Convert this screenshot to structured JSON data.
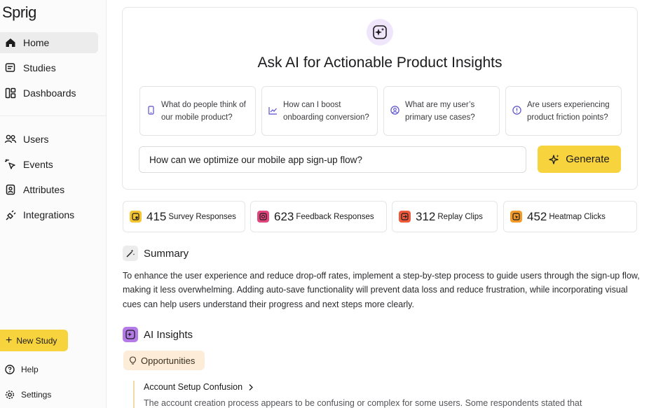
{
  "app": {
    "logo": "Sprig"
  },
  "sidebar": {
    "items": [
      {
        "label": "Home",
        "icon": "home-icon",
        "active": true
      },
      {
        "label": "Studies",
        "icon": "studies-icon"
      },
      {
        "label": "Dashboards",
        "icon": "dashboards-icon"
      },
      {
        "label": "Users",
        "icon": "users-icon"
      },
      {
        "label": "Events",
        "icon": "events-icon"
      },
      {
        "label": "Attributes",
        "icon": "attributes-icon"
      },
      {
        "label": "Integrations",
        "icon": "integrations-icon"
      }
    ],
    "new_study": "New Study",
    "footer": [
      {
        "label": "Help",
        "icon": "help-icon"
      },
      {
        "label": "Settings",
        "icon": "settings-icon"
      }
    ]
  },
  "ai_panel": {
    "badge_icon": "sparkle-icon",
    "title": "Ask AI for Actionable Product Insights",
    "suggestions": [
      {
        "text": "What do people think of our mobile product?",
        "icon": "mobile-icon"
      },
      {
        "text": "How can I boost onboarding conversion?",
        "icon": "trend-chart-icon"
      },
      {
        "text": "What are my user’s primary use cases?",
        "icon": "user-circle-icon"
      },
      {
        "text": "Are users experiencing product friction points?",
        "icon": "alert-circle-icon"
      }
    ],
    "query_value": "How can we optimize our mobile app sign-up flow?",
    "generate_label": "Generate"
  },
  "stats": [
    {
      "value": "415",
      "label": "Survey Responses",
      "color": "#f5c431",
      "icon": "survey-icon"
    },
    {
      "value": "623",
      "label": "Feedback Responses",
      "color": "#e0457b",
      "icon": "feedback-icon"
    },
    {
      "value": "312",
      "label": "Replay Clips",
      "color": "#ef5a3c",
      "icon": "replay-icon"
    },
    {
      "value": "452",
      "label": "Heatmap Clicks",
      "color": "#f39a2b",
      "icon": "heatmap-icon"
    }
  ],
  "summary": {
    "heading": "Summary",
    "text": "To enhance the user experience and reduce drop-off rates, implement a step-by-step process to guide users through the sign-up flow, making it less overwhelming. Adding auto-save functionality will prevent data loss and reduce frustration, while incorporating visual cues can help users understand their progress and next steps more clearly."
  },
  "insights": {
    "heading": "AI Insights",
    "tag": "Opportunities",
    "item_title": "Account Setup Confusion",
    "item_text": "The account creation process appears to be confusing or complex for some users. Some respondents stated that"
  },
  "colors": {
    "accent": "#f7d33d",
    "ai_purple": "#b47be8",
    "opportunity_bg": "#fcecd8"
  }
}
